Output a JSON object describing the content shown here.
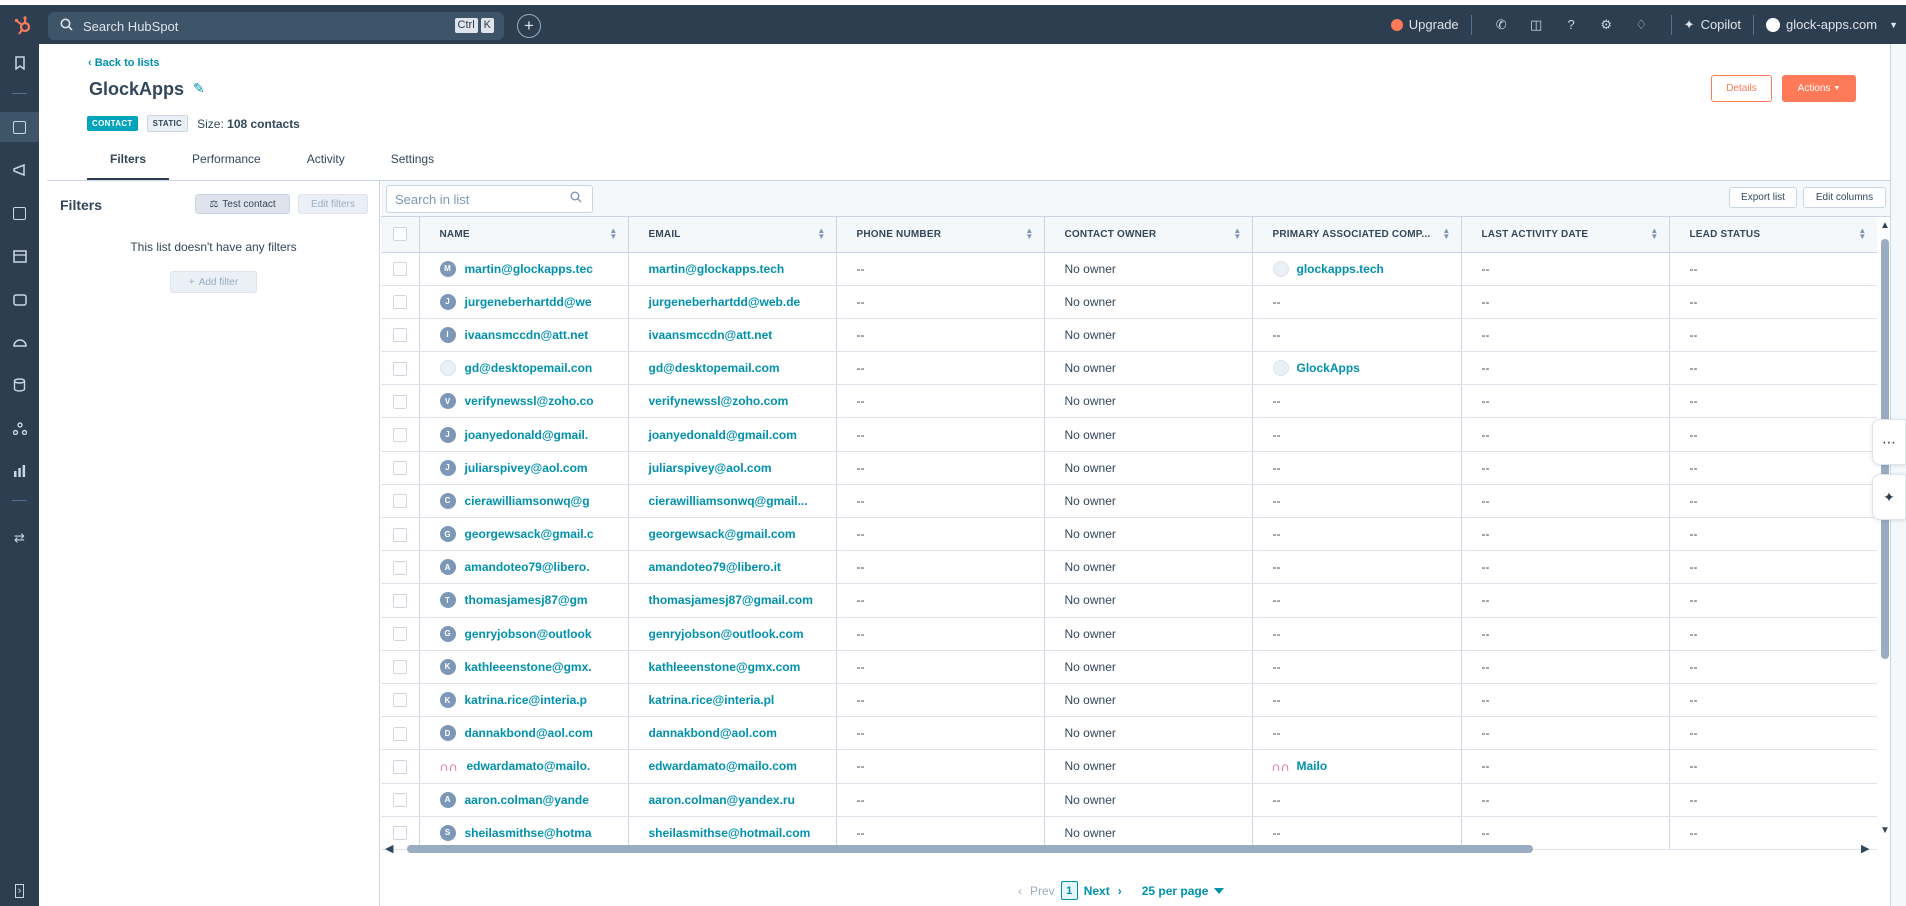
{
  "topbar": {
    "search_placeholder": "Search HubSpot",
    "kbd_ctrl": "Ctrl",
    "kbd_k": "K",
    "upgrade": "Upgrade",
    "copilot": "Copilot",
    "account": "glock-apps.com"
  },
  "header": {
    "back": "Back to lists",
    "title": "GlockApps",
    "tag_contact": "CONTACT",
    "tag_static": "STATIC",
    "size_label": "Size:",
    "size_value": "108 contacts",
    "details": "Details",
    "actions": "Actions"
  },
  "tabs": [
    "Filters",
    "Performance",
    "Activity",
    "Settings"
  ],
  "filters": {
    "heading": "Filters",
    "test_contact": "Test contact",
    "edit_filters": "Edit filters",
    "empty_text": "This list doesn't have any filters",
    "add_filter": "Add filter"
  },
  "list": {
    "search_placeholder": "Search in list",
    "export": "Export list",
    "edit_columns": "Edit columns",
    "columns": [
      "NAME",
      "EMAIL",
      "PHONE NUMBER",
      "CONTACT OWNER",
      "PRIMARY ASSOCIATED COMP...",
      "LAST ACTIVITY DATE",
      "LEAD STATUS"
    ],
    "rows": [
      {
        "initial": "M",
        "avatar": "letter",
        "name": "martin@glockapps.tec",
        "email": "martin@glockapps.tech",
        "phone": "--",
        "owner": "No owner",
        "company": "glockapps.tech",
        "company_logo": "circle",
        "last": "--",
        "lead": "--"
      },
      {
        "initial": "J",
        "avatar": "letter",
        "name": "jurgeneberhartdd@we",
        "email": "jurgeneberhartdd@web.de",
        "phone": "--",
        "owner": "No owner",
        "company": "--",
        "company_logo": "",
        "last": "--",
        "lead": "--"
      },
      {
        "initial": "I",
        "avatar": "letter",
        "name": "ivaansmccdn@att.net",
        "email": "ivaansmccdn@att.net",
        "phone": "--",
        "owner": "No owner",
        "company": "--",
        "company_logo": "",
        "last": "--",
        "lead": "--"
      },
      {
        "initial": "",
        "avatar": "img",
        "name": "gd@desktopemail.con",
        "email": "gd@desktopemail.com",
        "phone": "--",
        "owner": "No owner",
        "company": "GlockApps",
        "company_logo": "circle",
        "last": "--",
        "lead": "--"
      },
      {
        "initial": "V",
        "avatar": "letter",
        "name": "verifynewssl@zoho.co",
        "email": "verifynewssl@zoho.com",
        "phone": "--",
        "owner": "No owner",
        "company": "--",
        "company_logo": "",
        "last": "--",
        "lead": "--"
      },
      {
        "initial": "J",
        "avatar": "letter",
        "name": "joanyedonald@gmail.",
        "email": "joanyedonald@gmail.com",
        "phone": "--",
        "owner": "No owner",
        "company": "--",
        "company_logo": "",
        "last": "--",
        "lead": "--"
      },
      {
        "initial": "J",
        "avatar": "letter",
        "name": "juliarspivey@aol.com",
        "email": "juliarspivey@aol.com",
        "phone": "--",
        "owner": "No owner",
        "company": "--",
        "company_logo": "",
        "last": "--",
        "lead": "--"
      },
      {
        "initial": "C",
        "avatar": "letter",
        "name": "cierawilliamsonwq@g",
        "email": "cierawilliamsonwq@gmail...",
        "phone": "--",
        "owner": "No owner",
        "company": "--",
        "company_logo": "",
        "last": "--",
        "lead": "--"
      },
      {
        "initial": "G",
        "avatar": "letter",
        "name": "georgewsack@gmail.c",
        "email": "georgewsack@gmail.com",
        "phone": "--",
        "owner": "No owner",
        "company": "--",
        "company_logo": "",
        "last": "--",
        "lead": "--"
      },
      {
        "initial": "A",
        "avatar": "letter",
        "name": "amandoteo79@libero.",
        "email": "amandoteo79@libero.it",
        "phone": "--",
        "owner": "No owner",
        "company": "--",
        "company_logo": "",
        "last": "--",
        "lead": "--"
      },
      {
        "initial": "T",
        "avatar": "letter",
        "name": "thomasjamesj87@gm",
        "email": "thomasjamesj87@gmail.com",
        "phone": "--",
        "owner": "No owner",
        "company": "--",
        "company_logo": "",
        "last": "--",
        "lead": "--"
      },
      {
        "initial": "G",
        "avatar": "letter",
        "name": "genryjobson@outlook",
        "email": "genryjobson@outlook.com",
        "phone": "--",
        "owner": "No owner",
        "company": "--",
        "company_logo": "",
        "last": "--",
        "lead": "--"
      },
      {
        "initial": "K",
        "avatar": "letter",
        "name": "kathleeenstone@gmx.",
        "email": "kathleeenstone@gmx.com",
        "phone": "--",
        "owner": "No owner",
        "company": "--",
        "company_logo": "",
        "last": "--",
        "lead": "--"
      },
      {
        "initial": "K",
        "avatar": "letter",
        "name": "katrina.rice@interia.p",
        "email": "katrina.rice@interia.pl",
        "phone": "--",
        "owner": "No owner",
        "company": "--",
        "company_logo": "",
        "last": "--",
        "lead": "--"
      },
      {
        "initial": "D",
        "avatar": "letter",
        "name": "dannakbond@aol.com",
        "email": "dannakbond@aol.com",
        "phone": "--",
        "owner": "No owner",
        "company": "--",
        "company_logo": "",
        "last": "--",
        "lead": "--"
      },
      {
        "initial": "",
        "avatar": "mailo",
        "name": "edwardamato@mailo.",
        "email": "edwardamato@mailo.com",
        "phone": "--",
        "owner": "No owner",
        "company": "Mailo",
        "company_logo": "mailo",
        "last": "--",
        "lead": "--"
      },
      {
        "initial": "A",
        "avatar": "letter",
        "name": "aaron.colman@yande",
        "email": "aaron.colman@yandex.ru",
        "phone": "--",
        "owner": "No owner",
        "company": "--",
        "company_logo": "",
        "last": "--",
        "lead": "--"
      },
      {
        "initial": "S",
        "avatar": "letter",
        "name": "sheilasmithse@hotma",
        "email": "sheilasmithse@hotmail.com",
        "phone": "--",
        "owner": "No owner",
        "company": "--",
        "company_logo": "",
        "last": "--",
        "lead": "--"
      }
    ]
  },
  "pagination": {
    "prev": "Prev",
    "page": "1",
    "next": "Next",
    "per_page": "25 per page"
  },
  "colors": {
    "accent": "#ff7a59",
    "link": "#0091ae",
    "nav": "#2d3e50"
  }
}
